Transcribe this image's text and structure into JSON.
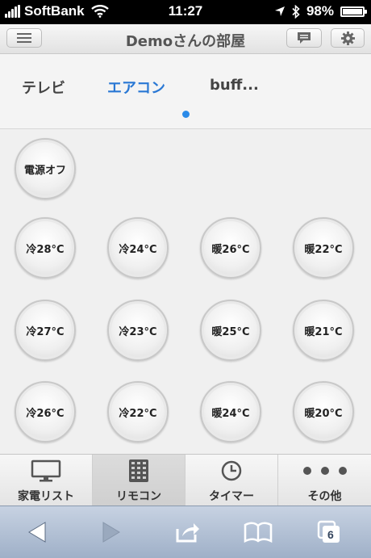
{
  "status": {
    "carrier": "SoftBank",
    "time": "11:27",
    "battery": "98%",
    "battery_level": 0.98
  },
  "header": {
    "title": "Demoさんの部屋"
  },
  "tabs": [
    {
      "label": "テレビ",
      "active": false
    },
    {
      "label": "エアコン",
      "active": true
    },
    {
      "label": "buff...",
      "active": false
    }
  ],
  "remote": {
    "power_label": "電源オフ",
    "buttons": [
      [
        "冷28°C",
        "冷24°C",
        "暖26°C",
        "暖22°C"
      ],
      [
        "冷27°C",
        "冷23°C",
        "暖25°C",
        "暖21°C"
      ],
      [
        "冷26°C",
        "冷22°C",
        "暖24°C",
        "暖20°C"
      ]
    ]
  },
  "bottom_tabs": [
    {
      "label": "家電リスト",
      "icon": "monitor-icon"
    },
    {
      "label": "リモコン",
      "icon": "keypad-icon",
      "active": true
    },
    {
      "label": "タイマー",
      "icon": "clock-icon"
    },
    {
      "label": "その他",
      "icon": "more-icon"
    }
  ],
  "safari": {
    "tabs_count": "6"
  },
  "colors": {
    "accent": "#2a78d4",
    "toolbar": "#b5c2d6"
  }
}
